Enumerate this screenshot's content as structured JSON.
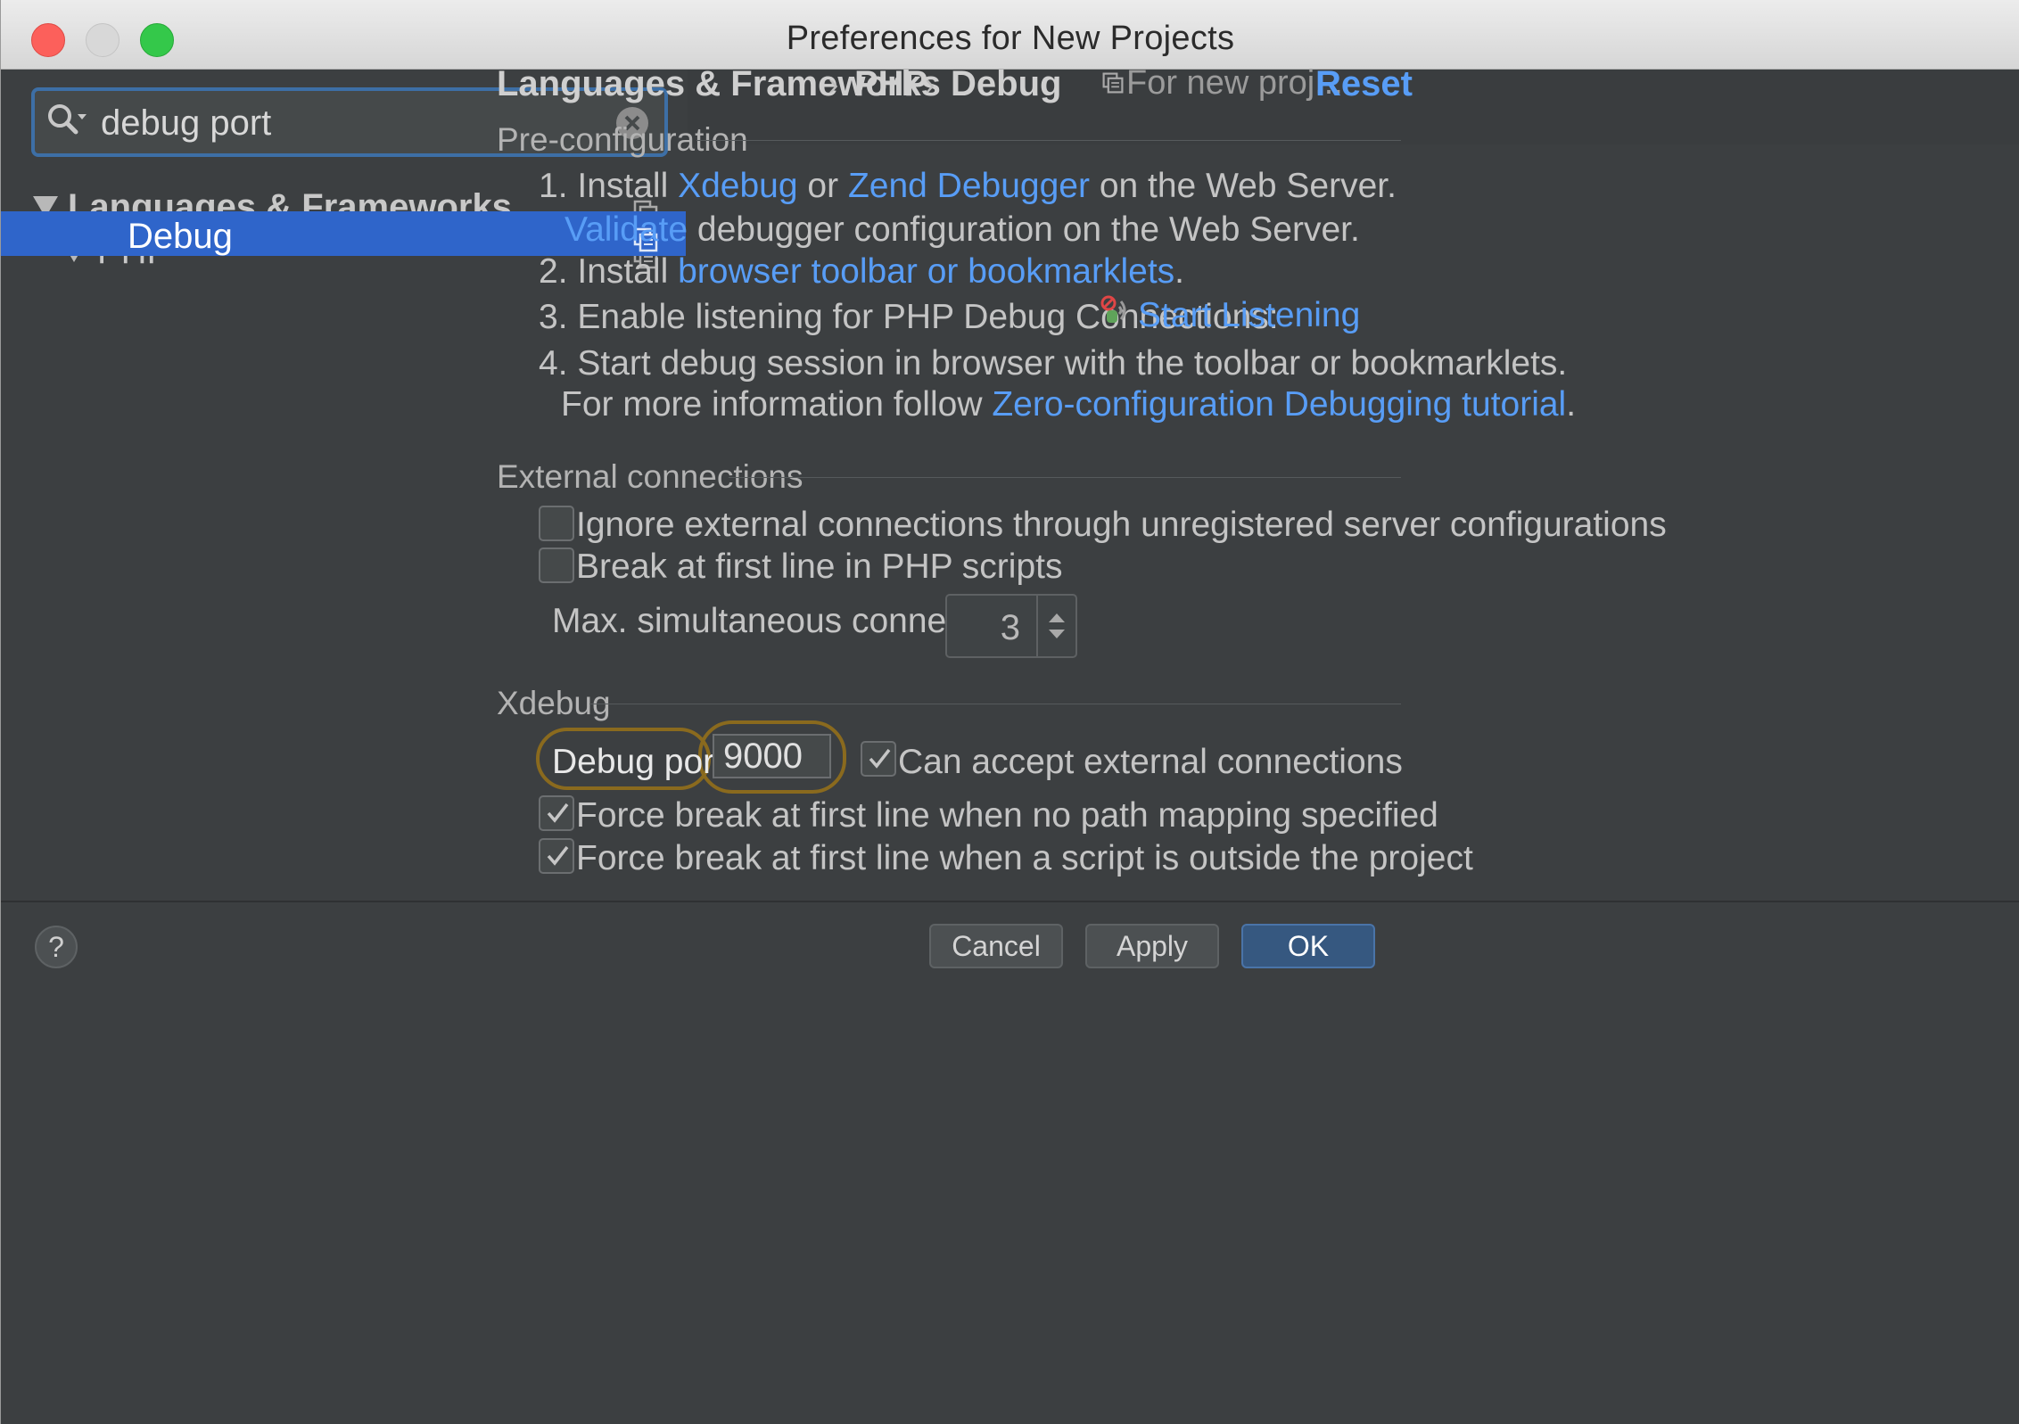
{
  "window": {
    "title": "Preferences for New Projects"
  },
  "sidebar": {
    "search": {
      "value": "debug port"
    },
    "tree": [
      {
        "label": "Languages & Frameworks",
        "expanded": true,
        "bold": true
      },
      {
        "label": "PHP",
        "expanded": true
      },
      {
        "label": "Debug",
        "selected": true
      }
    ]
  },
  "breadcrumb": {
    "items": [
      "Languages & Frameworks",
      "PHP",
      "Debug"
    ],
    "separator": "›",
    "for_new": "For new proj...",
    "reset": "Reset"
  },
  "preconfig": {
    "title": "Pre-configuration",
    "step1_prefix": "1. Install",
    "step1_link1": "Xdebug",
    "step1_or": "or",
    "step1_link2": "Zend Debugger",
    "step1_suffix": "on the Web Server.",
    "validate_link": "Validate",
    "validate_suffix": "debugger configuration on the Web Server.",
    "step2_prefix": "2. Install",
    "step2_link": "browser toolbar or bookmarklets",
    "step2_suffix": ".",
    "step3_prefix": "3. Enable listening for PHP Debug Connections:",
    "step3_link": "Start Listening",
    "step4": "4. Start debug session in browser with the toolbar or bookmarklets.",
    "more_prefix": "For more information follow",
    "more_link": "Zero-configuration Debugging tutorial",
    "more_suffix": "."
  },
  "external": {
    "title": "External connections",
    "ignore_label": "Ignore external connections through unregistered server configurations",
    "ignore_checked": false,
    "break_label": "Break at first line in PHP scripts",
    "break_checked": false,
    "max_label": "Max. simultaneous connections:",
    "max_value": "3"
  },
  "xdebug": {
    "title": "Xdebug",
    "port_label": "Debug port:",
    "port_value": "9000",
    "accept_label": "Can accept external connections",
    "accept_checked": true,
    "force1_label": "Force break at first line when no path mapping specified",
    "force1_checked": true,
    "force2_label": "Force break at first line when a script is outside the project",
    "force2_checked": true
  },
  "buttons": {
    "help": "?",
    "cancel": "Cancel",
    "apply": "Apply",
    "ok": "OK"
  },
  "colors": {
    "link": "#589df6",
    "selection": "#2f65ca",
    "highlight": "#8a6a1e"
  }
}
